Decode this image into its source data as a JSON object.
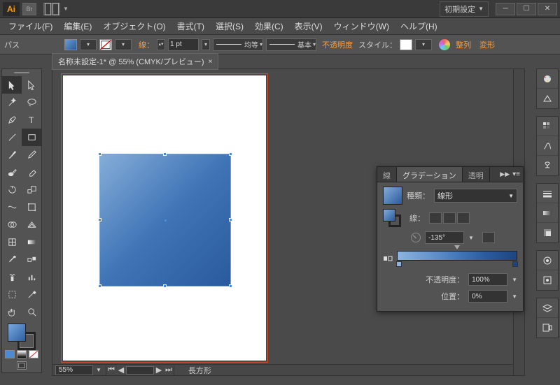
{
  "titlebar": {
    "logo": "Ai",
    "bridge": "Br",
    "workspace": "初期設定"
  },
  "menu": {
    "file": "ファイル(F)",
    "edit": "編集(E)",
    "object": "オブジェクト(O)",
    "format": "書式(T)",
    "select": "選択(S)",
    "effect": "効果(C)",
    "view": "表示(V)",
    "window": "ウィンドウ(W)",
    "help": "ヘルプ(H)"
  },
  "control": {
    "path_label": "パス",
    "stroke_label": "線：",
    "stroke_weight": "1 pt",
    "brush1": "均等",
    "brush2": "基本",
    "opacity_label": "不透明度",
    "style_label": "スタイル：",
    "align": "整列",
    "transform": "変形"
  },
  "doc": {
    "tab": "名称未設定-1* @ 55% (CMYK/プレビュー)",
    "zoom": "55%",
    "status": "長方形"
  },
  "panel": {
    "tab_stroke": "線",
    "tab_gradient": "グラデーション",
    "tab_transparency": "透明",
    "type_label": "種類：",
    "type_value": "線形",
    "stroke_row_label": "線：",
    "angle_label": "-135°",
    "opacity_label": "不透明度：",
    "opacity_value": "100%",
    "location_label": "位置：",
    "location_value": "0%"
  }
}
